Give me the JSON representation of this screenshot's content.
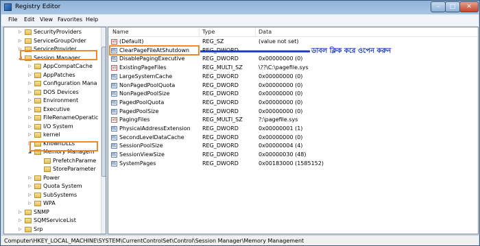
{
  "window": {
    "title": "Registry Editor",
    "controls": {
      "minimize": "–",
      "maximize": "□",
      "close": "✕"
    }
  },
  "menubar": [
    "File",
    "Edit",
    "View",
    "Favorites",
    "Help"
  ],
  "tree": {
    "items": [
      {
        "label": "SecurityProviders",
        "level": 1
      },
      {
        "label": "ServiceGroupOrder",
        "level": 1
      },
      {
        "label": "ServiceProvider",
        "level": 1
      },
      {
        "label": "Session Manager",
        "level": 1
      },
      {
        "label": "AppCompatCache",
        "level": 2
      },
      {
        "label": "AppPatches",
        "level": 2
      },
      {
        "label": "Configuration Mana",
        "level": 2
      },
      {
        "label": "DOS Devices",
        "level": 2
      },
      {
        "label": "Environment",
        "level": 2
      },
      {
        "label": "Executive",
        "level": 2
      },
      {
        "label": "FileRenameOperatic",
        "level": 2
      },
      {
        "label": "I/O System",
        "level": 2
      },
      {
        "label": "kernel",
        "level": 2
      },
      {
        "label": "KnownDLLs",
        "level": 2
      },
      {
        "label": "Memory Managem",
        "level": 2
      },
      {
        "label": "PrefetchParame",
        "level": 3
      },
      {
        "label": "StoreParameter",
        "level": 3
      },
      {
        "label": "Power",
        "level": 2
      },
      {
        "label": "Quota System",
        "level": 2
      },
      {
        "label": "SubSystems",
        "level": 2
      },
      {
        "label": "WPA",
        "level": 2
      },
      {
        "label": "SNMP",
        "level": 1
      },
      {
        "label": "SQMServiceList",
        "level": 1
      },
      {
        "label": "Srp",
        "level": 1
      }
    ]
  },
  "list": {
    "columns": [
      "Name",
      "Type",
      "Data"
    ],
    "rows": [
      {
        "name": "(Default)",
        "type": "REG_SZ",
        "data": "(value not set)",
        "kind": "str"
      },
      {
        "name": "ClearPageFileAtShutdown",
        "type": "REG_DWORD",
        "data": "",
        "kind": "bin"
      },
      {
        "name": "DisablePagingExecutive",
        "type": "REG_DWORD",
        "data": "0x00000000 (0)",
        "kind": "bin"
      },
      {
        "name": "ExistingPageFiles",
        "type": "REG_MULTI_SZ",
        "data": "\\??\\C:\\pagefile.sys",
        "kind": "str"
      },
      {
        "name": "LargeSystemCache",
        "type": "REG_DWORD",
        "data": "0x00000000 (0)",
        "kind": "bin"
      },
      {
        "name": "NonPagedPoolQuota",
        "type": "REG_DWORD",
        "data": "0x00000000 (0)",
        "kind": "bin"
      },
      {
        "name": "NonPagedPoolSize",
        "type": "REG_DWORD",
        "data": "0x00000000 (0)",
        "kind": "bin"
      },
      {
        "name": "PagedPoolQuota",
        "type": "REG_DWORD",
        "data": "0x00000000 (0)",
        "kind": "bin"
      },
      {
        "name": "PagedPoolSize",
        "type": "REG_DWORD",
        "data": "0x00000000 (0)",
        "kind": "bin"
      },
      {
        "name": "PagingFiles",
        "type": "REG_MULTI_SZ",
        "data": "?:\\pagefile.sys",
        "kind": "str"
      },
      {
        "name": "PhysicalAddressExtension",
        "type": "REG_DWORD",
        "data": "0x00000001 (1)",
        "kind": "bin"
      },
      {
        "name": "SecondLevelDataCache",
        "type": "REG_DWORD",
        "data": "0x00000000 (0)",
        "kind": "bin"
      },
      {
        "name": "SessionPoolSize",
        "type": "REG_DWORD",
        "data": "0x00000004 (4)",
        "kind": "bin"
      },
      {
        "name": "SessionViewSize",
        "type": "REG_DWORD",
        "data": "0x00000030 (48)",
        "kind": "bin"
      },
      {
        "name": "SystemPages",
        "type": "REG_DWORD",
        "data": "0x00183000 (1585152)",
        "kind": "bin"
      }
    ]
  },
  "annotation": "ডাবল ক্লিক করে ওপেন করুন",
  "statusbar": "Computer\\HKEY_LOCAL_MACHINE\\SYSTEM\\CurrentControlSet\\Control\\Session Manager\\Memory Management",
  "colors": {
    "highlight": "#f0892c",
    "annotation": "#1a3ab8"
  }
}
